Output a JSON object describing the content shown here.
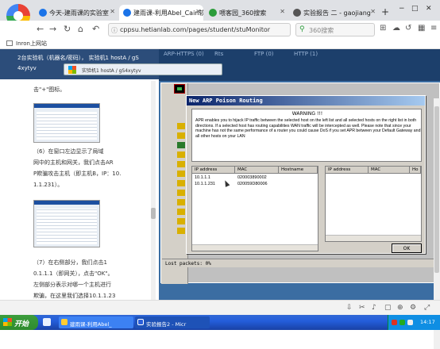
{
  "browser": {
    "tabs": [
      {
        "label": "今天-建雨课的实验室",
        "color": "#1a73e8"
      },
      {
        "label": "建雨课-利用Abel_Cain软",
        "color": "#1a73e8"
      },
      {
        "label": "喂客园_360搜索",
        "color": "#2b9c3a"
      },
      {
        "label": "实验报告 二 - gaojiang",
        "color": "#555555"
      }
    ],
    "new_tab": "+",
    "window_buttons": [
      "−",
      "□",
      "✕"
    ],
    "url": "cppsu.hetianlab.com/pages/student/stuMonitor",
    "search_placeholder": "360搜索",
    "bookmark": "Inron上网站"
  },
  "left_panel": {
    "header_line1": "2台实验机（机器名/密码）， 实验机1 hostA / gS",
    "header_line2": "4xytyv",
    "remote_bar_label": "实验机1  hostA / gS4xytyv",
    "text_top": "击\"+\"图标。",
    "para6_lines": [
      "（6）在窗口左边显示了局域",
      "网中的主机和网关，我们点击AR",
      "P欺骗攻击主机（即主机B，IP：10.",
      "1.1.231）。"
    ],
    "para7_lines": [
      "（7）在右侧部分，我们点击1",
      "0.1.1.1（即网关），点击\"OK\"。",
      "左侧部分表示对哪一个主机进行",
      "欺骗，在这里我们选择10.1.1.23"
    ]
  },
  "remote": {
    "ghost_tabs": [
      "ARP-HTTPS (0)",
      "Rts",
      "FTP (0)",
      "HTTP (1)"
    ],
    "status_bar": "Lost packets:   0%"
  },
  "dialog": {
    "title": "New ARP Poison Routing",
    "warning_title": "WARNING !!!",
    "warning_text": "APR enables you to hijack IP traffic between the selected host on the left list and all selected hosts on the right list in both directions. If a selected host has routing capabilities WAN traffic will be intercepted as well. Please note that since your machine has not the same performance of a router you could cause DoS if you set APR between your Default Gateway and all other hosts on your LAN",
    "left_list": {
      "headers": [
        "IP address",
        "MAC",
        "Hostname"
      ],
      "rows": [
        [
          "10.1.1.1",
          "020003890002",
          ""
        ],
        [
          "10.1.1.231",
          "020059D80006",
          ""
        ]
      ]
    },
    "right_list": {
      "headers": [
        "IP address",
        "MAC",
        "Ho"
      ],
      "rows": []
    },
    "ok_label": "OK"
  },
  "taskbar": {
    "start_label": "开始",
    "tasks": [
      "建雨课-利用Abel_",
      "实验报告2 - Micr"
    ],
    "clock": "14:17"
  }
}
